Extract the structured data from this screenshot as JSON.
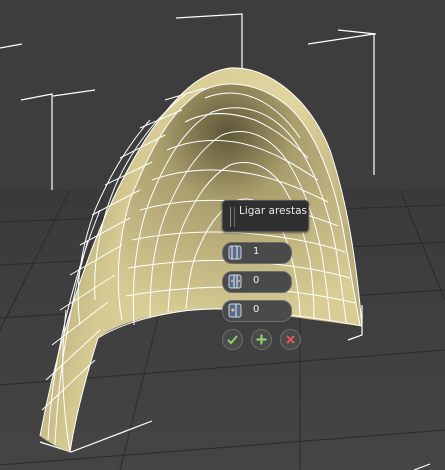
{
  "caddy": {
    "title": "Ligar arestas",
    "segments": "1",
    "pinch": "0",
    "slide": "0"
  },
  "icons": {
    "segments": "segments-icon",
    "pinch": "pinch-icon",
    "slide": "slide-icon",
    "ok": "check-icon",
    "apply": "plus-icon",
    "cancel": "close-icon"
  },
  "colors": {
    "viewport_background": "#3d3d3d",
    "mesh_fill": "#cfc28a",
    "wireframe": "#ffffff",
    "ok": "#8fd16a",
    "apply": "#8fd16a",
    "cancel": "#e05555"
  }
}
